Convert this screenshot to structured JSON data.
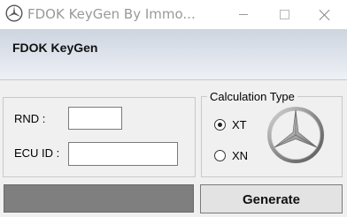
{
  "window": {
    "title": "FDOK KeyGen By Immo...",
    "icons": {
      "app": "mercedes-star-icon",
      "minimize": "minimize-icon",
      "maximize": "maximize-icon",
      "close": "close-icon"
    }
  },
  "header": {
    "title": "FDOK KeyGen"
  },
  "inputs": {
    "rnd_label": "RND :",
    "rnd_value": "",
    "ecu_label": "ECU ID :",
    "ecu_value": ""
  },
  "calculation": {
    "legend": "Calculation Type",
    "options": [
      {
        "label": "XT",
        "checked": true
      },
      {
        "label": "XN",
        "checked": false
      }
    ],
    "logo_icon": "mercedes-star-icon"
  },
  "actions": {
    "generate_label": "Generate"
  },
  "status": {
    "text": ""
  },
  "colors": {
    "status_bar": "#7f7f7f",
    "header_gradient_top": "#cdd5e0",
    "header_gradient_bottom": "#eef1f5"
  }
}
